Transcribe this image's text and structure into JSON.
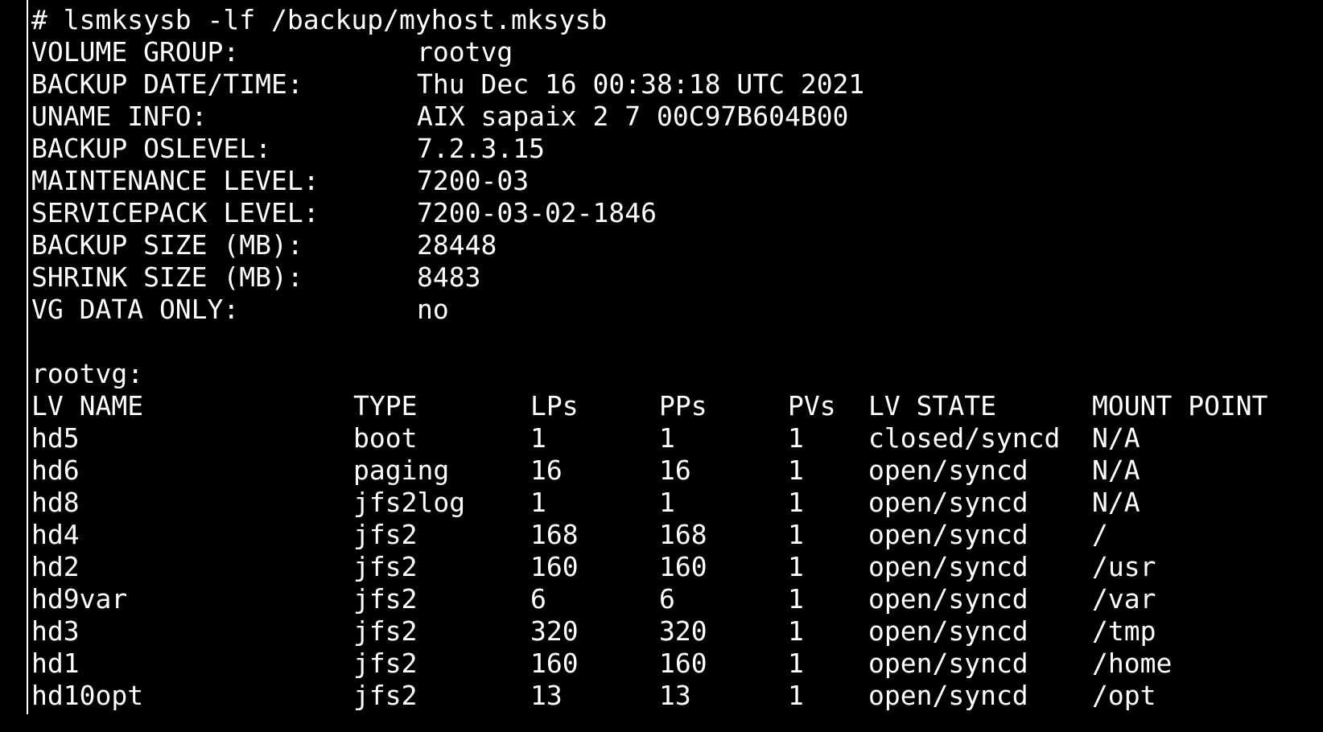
{
  "terminal": {
    "command": "# lsmksysb -lf /backup/myhost.mksysb",
    "info": [
      {
        "label": "VOLUME GROUP:",
        "value": "rootvg"
      },
      {
        "label": "BACKUP DATE/TIME:",
        "value": "Thu Dec 16 00:38:18 UTC 2021"
      },
      {
        "label": "UNAME INFO:",
        "value": "AIX sapaix 2 7 00C97B604B00"
      },
      {
        "label": "BACKUP OSLEVEL:",
        "value": "7.2.3.15"
      },
      {
        "label": "MAINTENANCE LEVEL:",
        "value": "7200-03"
      },
      {
        "label": "SERVICEPACK LEVEL:",
        "value": "7200-03-02-1846"
      },
      {
        "label": "BACKUP SIZE (MB):",
        "value": "28448"
      },
      {
        "label": "SHRINK SIZE (MB):",
        "value": "8483"
      },
      {
        "label": "VG DATA ONLY:",
        "value": "no"
      }
    ],
    "vg_name": "rootvg:",
    "table": {
      "headers": [
        "LV NAME",
        "TYPE",
        "LPs",
        "PPs",
        "PVs",
        "LV STATE",
        "MOUNT POINT"
      ],
      "rows": [
        [
          "hd5",
          "boot",
          "1",
          "1",
          "1",
          "closed/syncd",
          "N/A"
        ],
        [
          "hd6",
          "paging",
          "16",
          "16",
          "1",
          "open/syncd",
          "N/A"
        ],
        [
          "hd8",
          "jfs2log",
          "1",
          "1",
          "1",
          "open/syncd",
          "N/A"
        ],
        [
          "hd4",
          "jfs2",
          "168",
          "168",
          "1",
          "open/syncd",
          "/"
        ],
        [
          "hd2",
          "jfs2",
          "160",
          "160",
          "1",
          "open/syncd",
          "/usr"
        ],
        [
          "hd9var",
          "jfs2",
          "6",
          "6",
          "1",
          "open/syncd",
          "/var"
        ],
        [
          "hd3",
          "jfs2",
          "320",
          "320",
          "1",
          "open/syncd",
          "/tmp"
        ],
        [
          "hd1",
          "jfs2",
          "160",
          "160",
          "1",
          "open/syncd",
          "/home"
        ],
        [
          "hd10opt",
          "jfs2",
          "13",
          "13",
          "1",
          "open/syncd",
          "/opt"
        ]
      ]
    },
    "colors": {
      "background": "#000000",
      "foreground": "#ffffff"
    }
  }
}
